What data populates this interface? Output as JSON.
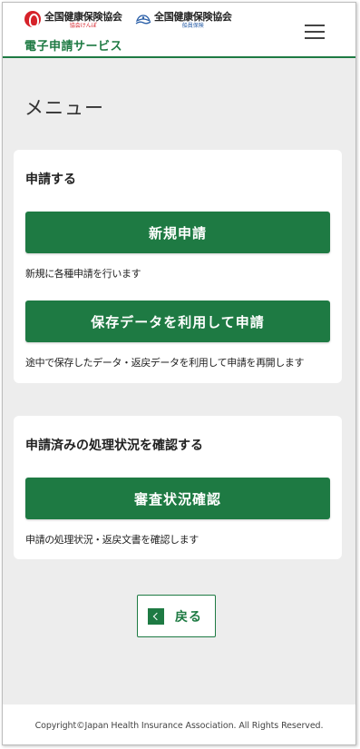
{
  "header": {
    "logo1_name": "全国健康保険協会",
    "logo1_sub": "協会けんぽ",
    "logo2_name": "全国健康保険協会",
    "logo2_sub": "船員保険",
    "service_name": "電子申請サービス"
  },
  "page_title": "メニュー",
  "sections": [
    {
      "title": "申請する",
      "actions": [
        {
          "button": "新規申請",
          "description": "新規に各種申請を行います"
        },
        {
          "button": "保存データを利用して申請",
          "description": "途中で保存したデータ・返戻データを利用して申請を再開します"
        }
      ]
    },
    {
      "title": "申請済みの処理状況を確認する",
      "actions": [
        {
          "button": "審査状況確認",
          "description": "申請の処理状況・返戻文書を確認します"
        }
      ]
    }
  ],
  "back_button": "戻る",
  "footer": {
    "copyright": "Copyright©Japan Health Insurance Association. All Rights Reserved."
  },
  "colors": {
    "brand_green": "#1e7a43",
    "logo_red": "#d6222a",
    "logo_blue": "#2a5fa8",
    "background": "#ededed"
  },
  "icons": {
    "menu": "hamburger-menu-icon",
    "back": "chevron-left-icon",
    "logo1": "kyokai-kenpo-logo-icon",
    "logo2": "senin-hoken-logo-icon"
  }
}
